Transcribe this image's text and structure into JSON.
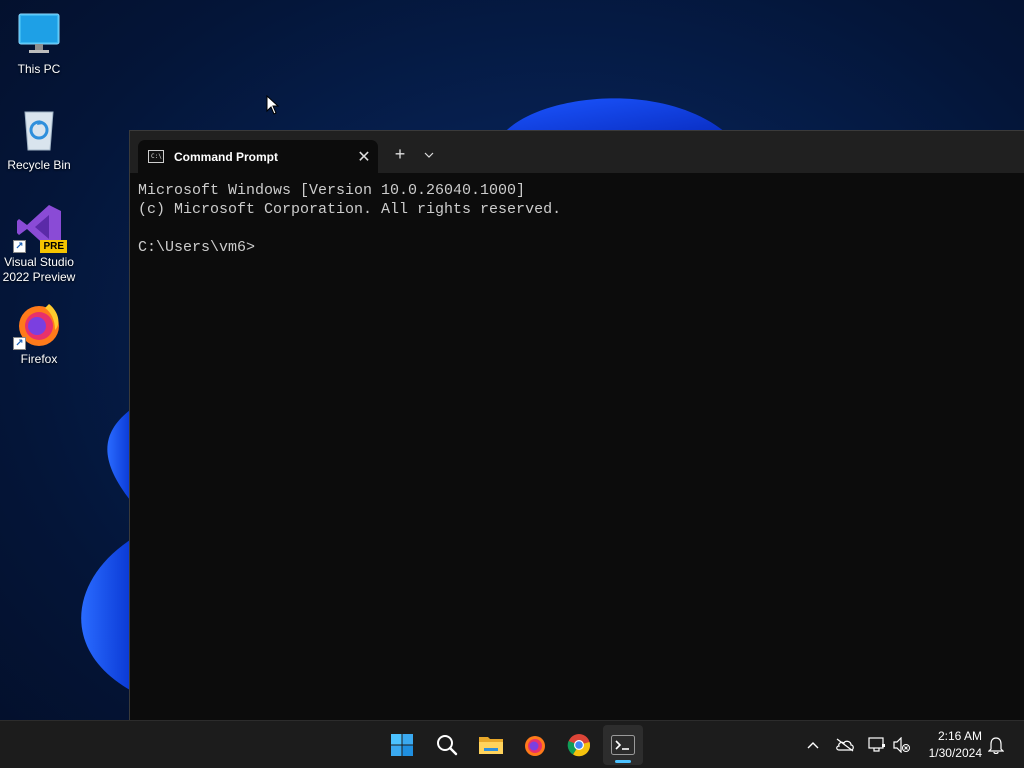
{
  "desktop": {
    "icons": [
      {
        "label": "This PC"
      },
      {
        "label": "Recycle Bin"
      },
      {
        "label": "Visual Studio 2022 Preview",
        "badge": "PRE"
      },
      {
        "label": "Firefox"
      }
    ]
  },
  "terminal": {
    "tab_title": "Command Prompt",
    "tab_icon_text": "C:\\",
    "new_tab": "+",
    "console_lines": [
      "Microsoft Windows [Version 10.0.26040.1000]",
      "(c) Microsoft Corporation. All rights reserved.",
      "",
      "C:\\Users\\vm6>"
    ]
  },
  "taskbar": {
    "apps": [
      "start-icon",
      "search-icon",
      "file-explorer-icon",
      "firefox-icon",
      "chrome-icon",
      "terminal-icon"
    ],
    "active_app": "terminal-icon",
    "tray": [
      "chevron-up-icon",
      "onedrive-icon",
      "network-icon",
      "volume-muted-icon"
    ],
    "time": "2:16 AM",
    "date": "1/30/2024"
  },
  "colors": {
    "accent": "#4cc2ff",
    "console_bg": "#0c0c0c",
    "console_fg": "#cccccc"
  }
}
